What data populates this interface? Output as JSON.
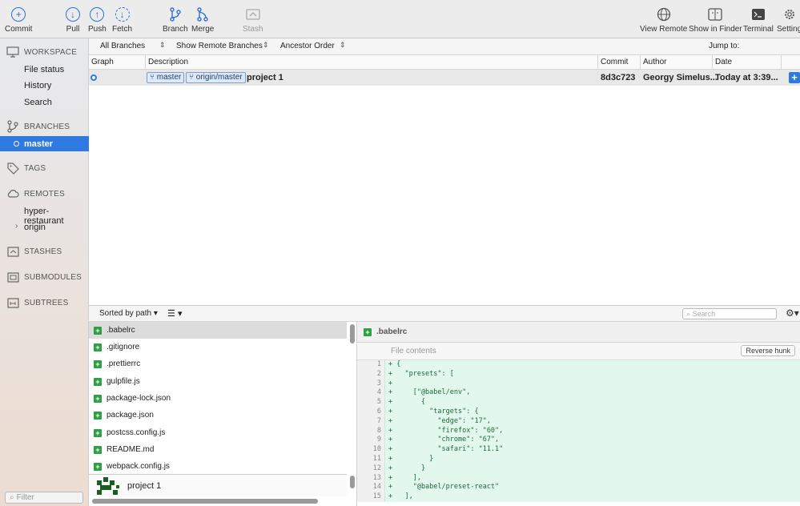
{
  "toolbar": {
    "commit": "Commit",
    "pull": "Pull",
    "push": "Push",
    "fetch": "Fetch",
    "branch": "Branch",
    "merge": "Merge",
    "stash": "Stash",
    "view_remote": "View Remote",
    "show_in_finder": "Show in Finder",
    "terminal": "Terminal",
    "settings": "Setting"
  },
  "sidebar": {
    "workspace": "WORKSPACE",
    "file_status": "File status",
    "history": "History",
    "search": "Search",
    "branches": "BRANCHES",
    "master": "master",
    "tags": "TAGS",
    "remotes": "REMOTES",
    "remote1": "hyper-restaurant",
    "remote2": "origin",
    "stashes": "STASHES",
    "submodules": "SUBMODULES",
    "subtrees": "SUBTREES",
    "filter_placeholder": "Filter"
  },
  "filterbar": {
    "branches": "All Branches",
    "remote": "Show Remote Branches",
    "order": "Ancestor Order",
    "jump": "Jump to:"
  },
  "columns": {
    "graph": "Graph",
    "description": "Description",
    "commit": "Commit",
    "author": "Author",
    "date": "Date"
  },
  "commit_row": {
    "tag1": "master",
    "tag2": "origin/master",
    "message": "project 1",
    "hash": "8d3c723",
    "author": "Georgy Simelus...",
    "date": "Today at 3:39..."
  },
  "files": {
    "sort": "Sorted by path",
    "search_placeholder": "Search",
    "list": [
      ".babelrc",
      ".gitignore",
      ".prettierrc",
      "gulpfile.js",
      "package-lock.json",
      "package.json",
      "postcss.config.js",
      "README.md",
      "webpack.config.js"
    ],
    "commit_message": "project 1"
  },
  "diff": {
    "filename": ".babelrc",
    "hunk_title": "File contents",
    "reverse": "Reverse hunk",
    "lines": [
      {
        "n": "1",
        "t": "+ {"
      },
      {
        "n": "2",
        "t": "+   \"presets\": ["
      },
      {
        "n": "3",
        "t": "+"
      },
      {
        "n": "4",
        "t": "+     [\"@babel/env\","
      },
      {
        "n": "5",
        "t": "+       {"
      },
      {
        "n": "6",
        "t": "+         \"targets\": {"
      },
      {
        "n": "7",
        "t": "+           \"edge\": \"17\","
      },
      {
        "n": "8",
        "t": "+           \"firefox\": \"60\","
      },
      {
        "n": "9",
        "t": "+           \"chrome\": \"67\","
      },
      {
        "n": "10",
        "t": "+           \"safari\": \"11.1\""
      },
      {
        "n": "11",
        "t": "+         }"
      },
      {
        "n": "12",
        "t": "+       }"
      },
      {
        "n": "13",
        "t": "+     ],"
      },
      {
        "n": "14",
        "t": "+     \"@babel/preset-react\""
      },
      {
        "n": "15",
        "t": "+   ],"
      }
    ]
  }
}
